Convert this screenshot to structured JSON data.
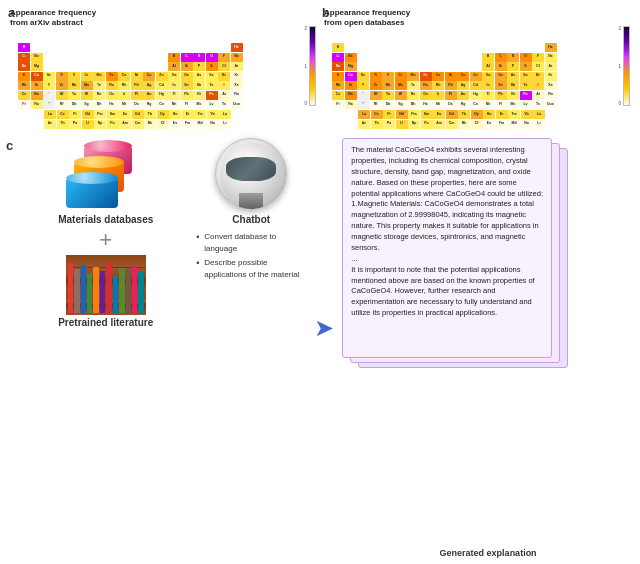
{
  "panels": {
    "a_label": "a",
    "b_label": "b",
    "c_label": "c",
    "a_title": "Appearance frequency from arXiv abstract",
    "b_title": "Appearance frequency from open databases",
    "colorbar_max": "2",
    "colorbar_mid": "1",
    "colorbar_min": "0"
  },
  "chatbot": {
    "label": "Chatbot",
    "bullet1": "Convert database to language",
    "bullet2": "Describe possible applications of the material"
  },
  "databases": {
    "label": "Materials databases"
  },
  "literature": {
    "label": "Pretrained literature"
  },
  "explanation": {
    "label": "Generated explanation",
    "text": "The material CaCoGeO4 exhibits several interesting properties, including its chemical composition, crystal structure, density, band gap, magnetization, and oxide nature. Based on these properties, here are some potential applications where CaCoGeO4 could be utilized:\n1.Magnetic Materials: CaCoGeO4 demonstrates a total magnetization of 2.99998045, indicating its magnetic nature. This property makes it suitable for applications in magnetic storage devices, spintronics, and magnetic sensors.\n...\nIt is important to note that the potential applications mentioned above are based on the known properties of CaCoGeO4. However, further research and experimentation are necessary to fully understand and utilize its properties in practical applications."
  },
  "periodic_table": {
    "elements_row1": [
      "H",
      "",
      "",
      "",
      "",
      "",
      "",
      "",
      "",
      "",
      "",
      "",
      "",
      "",
      "",
      "",
      "",
      "He"
    ],
    "elements_row2": [
      "Li",
      "Be",
      "",
      "",
      "",
      "",
      "",
      "",
      "",
      "",
      "",
      "",
      "B",
      "C",
      "N",
      "O",
      "F",
      "Ne"
    ],
    "elements_row3": [
      "Na",
      "Mg",
      "",
      "",
      "",
      "",
      "",
      "",
      "",
      "",
      "",
      "",
      "Al",
      "Si",
      "P",
      "S",
      "Cl",
      "Ar"
    ],
    "elements_row4": [
      "K",
      "Ca",
      "Sc",
      "Ti",
      "V",
      "Cr",
      "Mn",
      "Fe",
      "Co",
      "Ni",
      "Cu",
      "Zn",
      "Ga",
      "Ge",
      "As",
      "Se",
      "Br",
      "Kr"
    ],
    "elements_row5": [
      "Rb",
      "Sr",
      "Y",
      "Zr",
      "Nb",
      "Mo",
      "Tc",
      "Ru",
      "Rh",
      "Pd",
      "Ag",
      "Cd",
      "In",
      "Sn",
      "Sb",
      "Te",
      "I",
      "Xe"
    ],
    "elements_row6": [
      "Cs",
      "Ba",
      "",
      "Hf",
      "Ta",
      "W",
      "Re",
      "Os",
      "Ir",
      "Pt",
      "Au",
      "Hg",
      "Tl",
      "Pb",
      "Bi",
      "Po",
      "At",
      "Rn"
    ],
    "elements_row7": [
      "Fr",
      "Ra",
      "",
      "Rf",
      "Db",
      "Sg",
      "Bh",
      "Hs",
      "Mt",
      "Ds",
      "Rg",
      "Cn",
      "Nh",
      "Fl",
      "Mc",
      "Lv",
      "Ts",
      "Uuo"
    ],
    "lanthanides": [
      "La",
      "Ce",
      "Pr",
      "Nd",
      "Pm",
      "Sm",
      "Eu",
      "Gd",
      "Tb",
      "Dy",
      "Ho",
      "Er",
      "Tm",
      "Yb",
      "Lu"
    ],
    "actinides": [
      "Ac",
      "Th",
      "Pa",
      "U",
      "Np",
      "Pu",
      "Am",
      "Cm",
      "Bk",
      "Cf",
      "Es",
      "Fm",
      "Md",
      "No",
      "Lr"
    ]
  }
}
